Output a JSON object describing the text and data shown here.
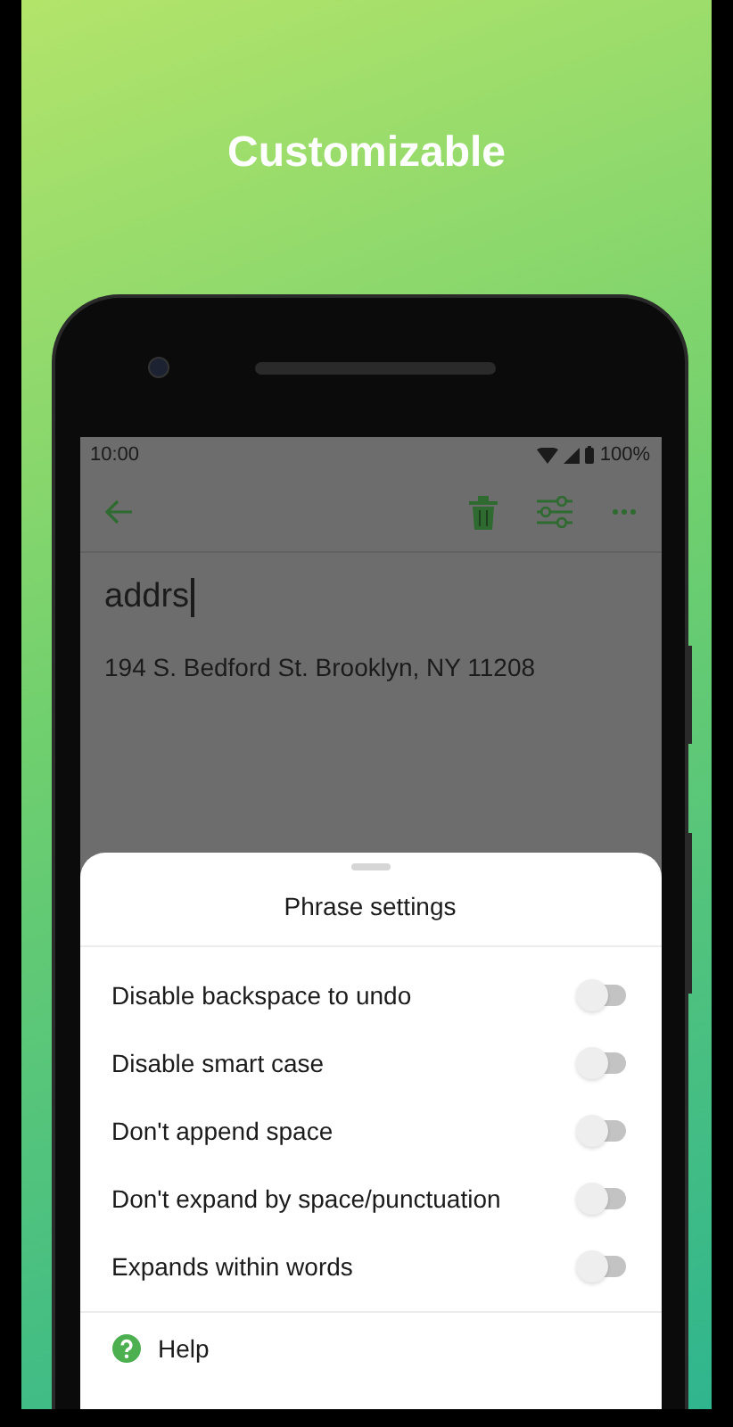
{
  "headline": "Customizable",
  "status_bar": {
    "time": "10:00",
    "battery": "100%"
  },
  "editor": {
    "abbreviation": "addrs",
    "phrase": "194 S. Bedford St. Brooklyn, NY 11208"
  },
  "sheet": {
    "title": "Phrase settings",
    "options": [
      {
        "label": "Disable backspace to undo",
        "checked": false
      },
      {
        "label": "Disable smart case",
        "checked": false
      },
      {
        "label": "Don't append space",
        "checked": false
      },
      {
        "label": "Don't expand by space/punctuation",
        "checked": false
      },
      {
        "label": "Expands within words",
        "checked": false
      }
    ],
    "help": "Help"
  }
}
